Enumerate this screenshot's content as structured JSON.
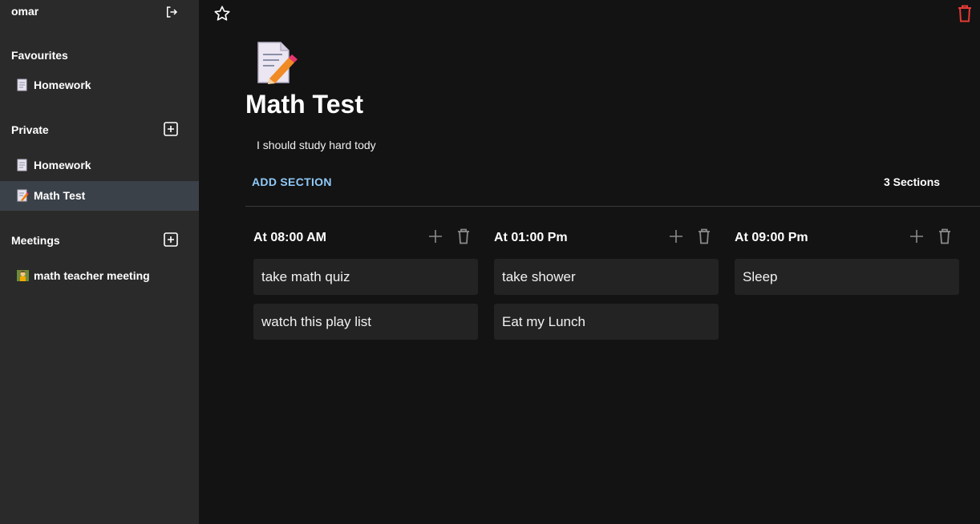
{
  "sidebar": {
    "user": "omar",
    "favourites": {
      "label": "Favourites",
      "items": [
        {
          "label": "Homework",
          "icon": "memo-emoji"
        }
      ]
    },
    "private": {
      "label": "Private",
      "items": [
        {
          "label": "Homework",
          "icon": "memo-emoji"
        },
        {
          "label": "Math Test",
          "icon": "memo-pencil-emoji",
          "active": true
        }
      ]
    },
    "meetings": {
      "label": "Meetings",
      "items": [
        {
          "label": "math teacher meeting",
          "icon": "teacher-emoji"
        }
      ]
    }
  },
  "page": {
    "icon": "memo-pencil-emoji",
    "title": "Math Test",
    "description": "I should study hard tody",
    "add_section_label": "ADD SECTION",
    "section_count": "3 Sections",
    "accent_color": "#90caf9",
    "danger_color": "#e53935"
  },
  "sections": [
    {
      "title": "At 08:00 AM",
      "cards": [
        "take math quiz",
        "watch this play list"
      ]
    },
    {
      "title": "At 01:00 Pm",
      "cards": [
        "take shower",
        "Eat my Lunch"
      ]
    },
    {
      "title": "At 09:00 Pm",
      "cards": [
        "Sleep"
      ]
    }
  ]
}
